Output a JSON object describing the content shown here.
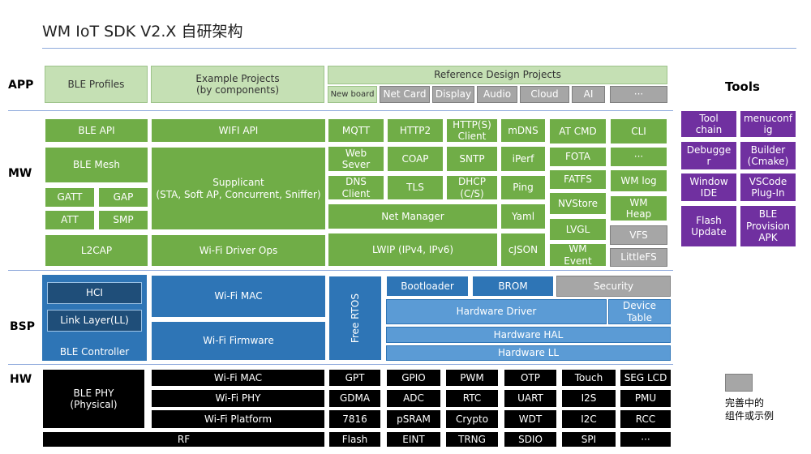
{
  "title": "WM IoT SDK V2.X 自研架构",
  "layers": {
    "app": "APP",
    "mw": "MW",
    "bsp": "BSP",
    "hw": "HW"
  },
  "tools_title": "Tools",
  "legend_text": "完善中的\n组件或示例",
  "colors": {
    "app": "#c5e0b4",
    "mw": "#70ad47",
    "bsp": "#2e75b6",
    "hw": "#000000",
    "tools": "#7030a0",
    "wip": "#a6a6a6"
  },
  "app": {
    "ble_profiles": "BLE Profiles",
    "example_projects": "Example Projects\n(by components)",
    "reference_design": "Reference Design Projects",
    "ref_items": [
      "New board",
      "Net Card",
      "Display",
      "Audio",
      "Cloud",
      "AI",
      "···"
    ]
  },
  "mw": {
    "ble_api": "BLE API",
    "ble_mesh": "BLE Mesh",
    "gatt": "GATT",
    "gap": "GAP",
    "att": "ATT",
    "smp": "SMP",
    "l2cap": "L2CAP",
    "wifi_api": "WIFI API",
    "supplicant": "Supplicant\n(STA, Soft AP, Concurrent, Sniffer)",
    "wifi_driver_ops": "Wi-Fi Driver Ops",
    "mqtt": "MQTT",
    "http2": "HTTP2",
    "https_client": "HTTP(S)\nClient",
    "mdns": "mDNS",
    "web_server": "Web\nSever",
    "coap": "COAP",
    "sntp": "SNTP",
    "iperf": "iPerf",
    "dns_client": "DNS\nClient",
    "tls": "TLS",
    "dhcp": "DHCP\n(C/S)",
    "ping": "Ping",
    "net_manager": "Net Manager",
    "yaml": "Yaml",
    "lwip": "LWIP (IPv4, IPv6)",
    "cjson": "cJSON",
    "at_cmd": "AT CMD",
    "fota": "FOTA",
    "fatfs": "FATFS",
    "nvstore": "NVStore",
    "lvgl": "LVGL",
    "wm_event": "WM\nEvent",
    "cli": "CLI",
    "more": "···",
    "wm_log": "WM log",
    "wm_heap": "WM\nHeap",
    "vfs": "VFS",
    "littlefs": "LittleFS"
  },
  "bsp": {
    "hci": "HCI",
    "link_layer": "Link Layer(LL)",
    "ble_controller": "BLE Controller",
    "wifi_mac": "Wi-Fi MAC",
    "wifi_firmware": "Wi-Fi Firmware",
    "free_rtos": "Free RTOS",
    "bootloader": "Bootloader",
    "brom": "BROM",
    "security": "Security",
    "hardware_driver": "Hardware Driver",
    "device_table": "Device\nTable",
    "hardware_hal": "Hardware HAL",
    "hardware_ll": "Hardware LL"
  },
  "hw": {
    "ble_phy": "BLE PHY\n(Physical)",
    "wifi_mac": "Wi-Fi MAC",
    "wifi_phy": "Wi-Fi PHY",
    "wifi_platform": "Wi-Fi Platform",
    "rf": "RF",
    "col1": [
      "GPT",
      "GDMA",
      "7816",
      "Flash"
    ],
    "col2": [
      "GPIO",
      "ADC",
      "pSRAM",
      "EINT"
    ],
    "col3": [
      "PWM",
      "RTC",
      "Crypto",
      "TRNG"
    ],
    "col4": [
      "OTP",
      "UART",
      "WDT",
      "SDIO"
    ],
    "col5": [
      "Touch",
      "I2S",
      "I2C",
      "SPI"
    ],
    "col6": [
      "SEG LCD",
      "PMU",
      "RCC",
      "···"
    ]
  },
  "tools": [
    "Tool\nchain",
    "menuconf\nig",
    "Debugge\nr",
    "Builder\n(Cmake)",
    "Window\nIDE",
    "VSCode\nPlug-In",
    "Flash\nUpdate",
    "BLE\nProvision\nAPK"
  ]
}
